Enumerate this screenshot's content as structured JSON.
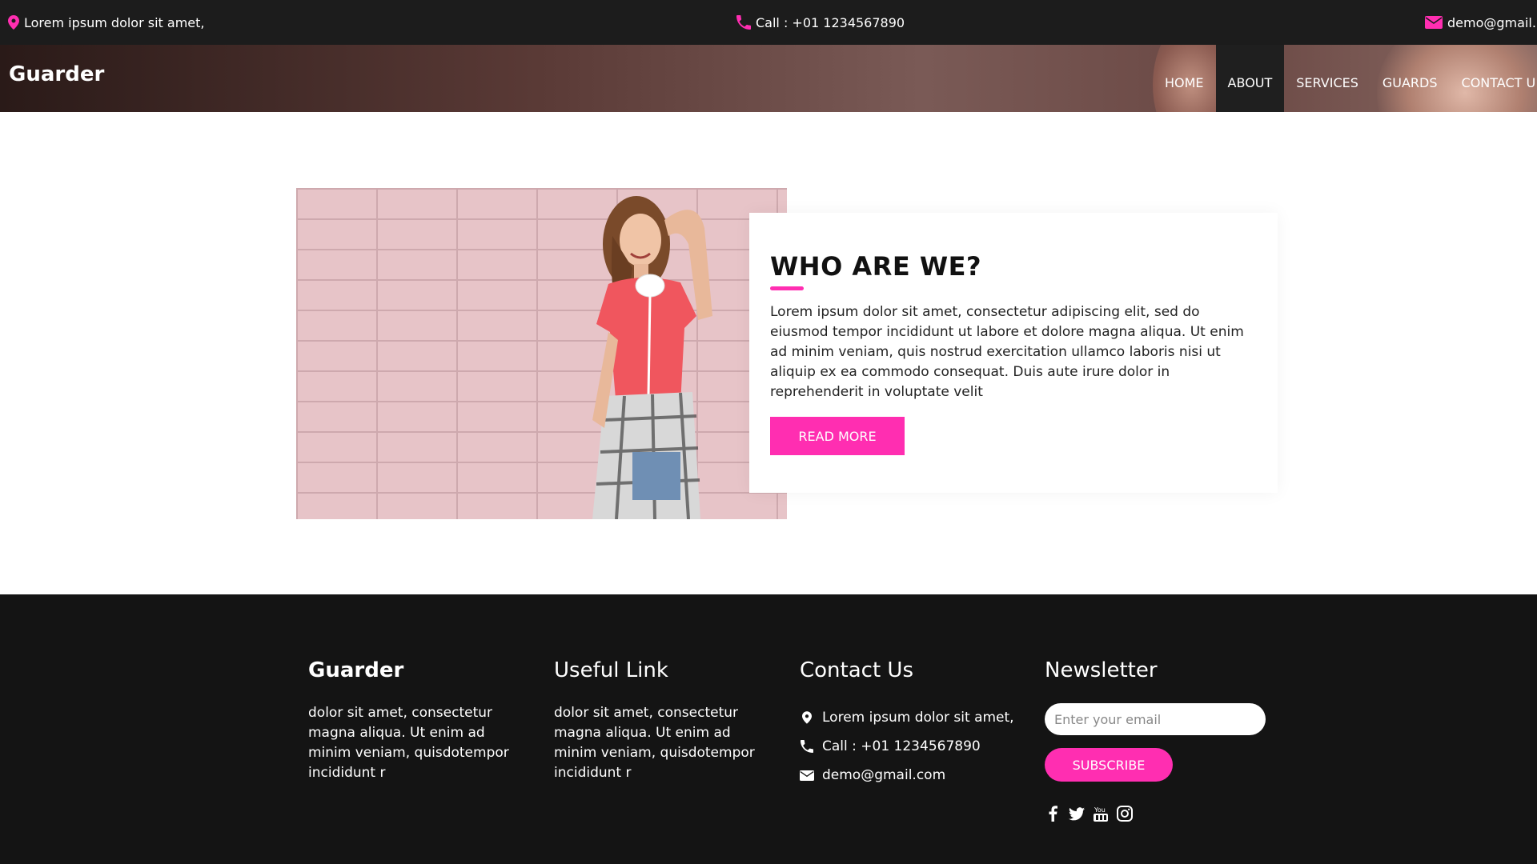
{
  "topbar": {
    "location": "Lorem ipsum dolor sit amet,",
    "call": "Call : +01 1234567890",
    "email": "demo@gmail."
  },
  "header": {
    "brand": "Guarder",
    "nav": [
      {
        "label": "HOME",
        "active": false
      },
      {
        "label": "ABOUT",
        "active": true
      },
      {
        "label": "SERVICES",
        "active": false
      },
      {
        "label": "GUARDS",
        "active": false
      },
      {
        "label": "CONTACT U",
        "active": false
      }
    ]
  },
  "about": {
    "title": "WHO ARE WE?",
    "text": "Lorem ipsum dolor sit amet, consectetur adipiscing elit, sed do eiusmod tempor incididunt ut labore et dolore magna aliqua. Ut enim ad minim veniam, quis nostrud exercitation ullamco laboris nisi ut aliquip ex ea commodo consequat. Duis aute irure dolor in reprehenderit in voluptate velit",
    "button": "READ MORE"
  },
  "footer": {
    "brand": "Guarder",
    "brand_text": "dolor sit amet, consectetur magna aliqua. Ut enim ad minim veniam, quisdotempor incididunt r",
    "useful_title": "Useful Link",
    "useful_text": "dolor sit amet, consectetur magna aliqua. Ut enim ad minim veniam, quisdotempor incididunt r",
    "contact_title": "Contact Us",
    "contact_location": "Lorem ipsum dolor sit amet,",
    "contact_call": "Call : +01 1234567890",
    "contact_email": "demo@gmail.com",
    "newsletter_title": "Newsletter",
    "newsletter_placeholder": "Enter your email",
    "subscribe": "SUBSCRIBE"
  },
  "colors": {
    "accent": "#ff2eb1",
    "dark": "#141414"
  },
  "icons": [
    "location-pin-icon",
    "phone-icon",
    "envelope-icon",
    "facebook-icon",
    "twitter-icon",
    "youtube-icon",
    "instagram-icon"
  ]
}
